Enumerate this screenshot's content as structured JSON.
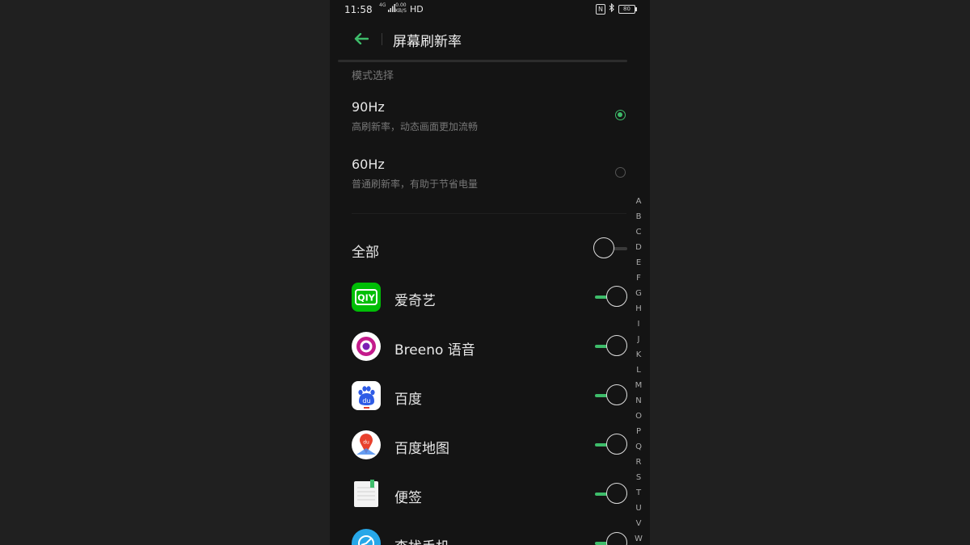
{
  "status_bar": {
    "time": "11:58",
    "network": "4G",
    "speed_value": "0.00",
    "speed_unit": "KB/S",
    "hd": "HD",
    "nfc": "N",
    "battery": "80"
  },
  "header": {
    "title": "屏幕刷新率"
  },
  "mode_section": {
    "label": "模式选择",
    "options": [
      {
        "title": "90Hz",
        "desc": "高刷新率，动态画面更加流畅",
        "selected": true
      },
      {
        "title": "60Hz",
        "desc": "普通刷新率，有助于节省电量",
        "selected": false
      }
    ]
  },
  "all_row": {
    "label": "全部",
    "on": false
  },
  "apps": [
    {
      "label": "爱奇艺",
      "icon": "iqiyi-icon",
      "on": true
    },
    {
      "label": "Breeno 语音",
      "icon": "breeno-icon",
      "on": true
    },
    {
      "label": "百度",
      "icon": "baidu-icon",
      "on": true
    },
    {
      "label": "百度地图",
      "icon": "baidu-map-icon",
      "on": true
    },
    {
      "label": "便签",
      "icon": "notes-icon",
      "on": true
    },
    {
      "label": "查找手机",
      "icon": "find-phone-icon",
      "on": true
    }
  ],
  "alpha_index": [
    "A",
    "B",
    "C",
    "D",
    "E",
    "F",
    "G",
    "H",
    "I",
    "J",
    "K",
    "L",
    "M",
    "N",
    "O",
    "P",
    "Q",
    "R",
    "S",
    "T",
    "U",
    "V",
    "W"
  ],
  "colors": {
    "accent": "#3ebc6a",
    "background": "#141414",
    "outer_background": "#202020"
  }
}
